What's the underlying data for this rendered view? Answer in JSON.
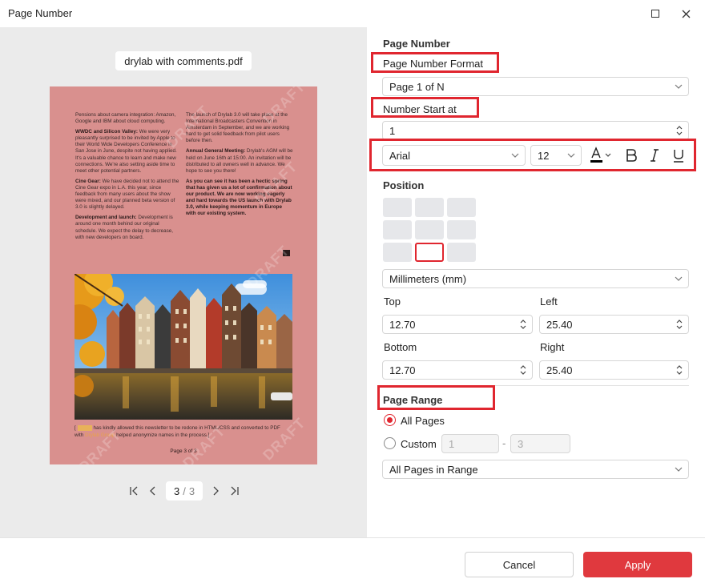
{
  "window": {
    "title": "Page Number"
  },
  "preview": {
    "filename": "drylab with comments.pdf",
    "page_content": {
      "col1": {
        "p1": "Pensions about camera integration: Amazon, Google and IBM about cloud computing.",
        "p2_head": "WWDC and Silicon Valley:",
        "p2_body": " We were very pleasantly surprised to be invited by Apple to their World Wide Developers Conference in San Jose in June, despite not having applied. It's a valuable chance to learn and make new connections. We're also setting aside time to meet other potential partners.",
        "p3_head": "Cine Gear:",
        "p3_body": " We have decided not to attend the Cine Gear expo in L.A. this year, since feedback from many users about the show were mixed, and our planned beta version of 3.0 is slightly delayed.",
        "p4_head": "Development and launch:",
        "p4_body": " Development is around one month behind our original schedule. We expect the delay to decrease, with new developers on board."
      },
      "col2": {
        "p1": "The launch of Drylab 3.0 will take place at the International Broadcasters Convention in Amsterdam in September, and we are working hard to get solid feedback from pilot users before then.",
        "p2_head": "Annual General Meeting:",
        "p2_body": " Drylab's AGM will be held on June 16th at 15:00. An invitation will be distributed to all owners well in advance. We hope to see you there!",
        "p3": "As you can see it has been a hectic spring that has given us a lot of confirmation about our product. We are now working eagerly and hard towards the US launch with Drylab 3.0, while keeping momentum in Europe with our existing system."
      },
      "footer_line1": "has kindly allowed this newsletter to be redone in HTML/CSS and converted to PDF",
      "footer_line2": "helped anonymize names in the process.]",
      "footer_prefix1": "[",
      "footer_prefix2": "with",
      "page_label": "Page 3 of 3",
      "watermark": "DRAFT"
    },
    "pager": {
      "current": "3",
      "separator": "/",
      "total": "3"
    }
  },
  "settings": {
    "title": "Page Number",
    "format_label": "Page Number Format",
    "format_value": "Page 1 of N",
    "start_label": "Number Start at",
    "start_value": "1",
    "font_family": "Arial",
    "font_size": "12",
    "position_title": "Position",
    "unit_value": "Millimeters (mm)",
    "top_label": "Top",
    "top_value": "12.70",
    "left_label": "Left",
    "left_value": "25.40",
    "bottom_label": "Bottom",
    "bottom_value": "12.70",
    "right_label": "Right",
    "right_value": "25.40",
    "range_title": "Page Range",
    "all_pages_label": "All Pages",
    "custom_label": "Custom",
    "custom_from_placeholder": "1",
    "custom_dash": "-",
    "custom_to_placeholder": "3",
    "range_filter_value": "All Pages in Range"
  },
  "footer": {
    "cancel": "Cancel",
    "apply": "Apply"
  },
  "colors": {
    "accent": "#e0393e",
    "highlight": "#e0262f",
    "page_bg": "#d9908e"
  }
}
